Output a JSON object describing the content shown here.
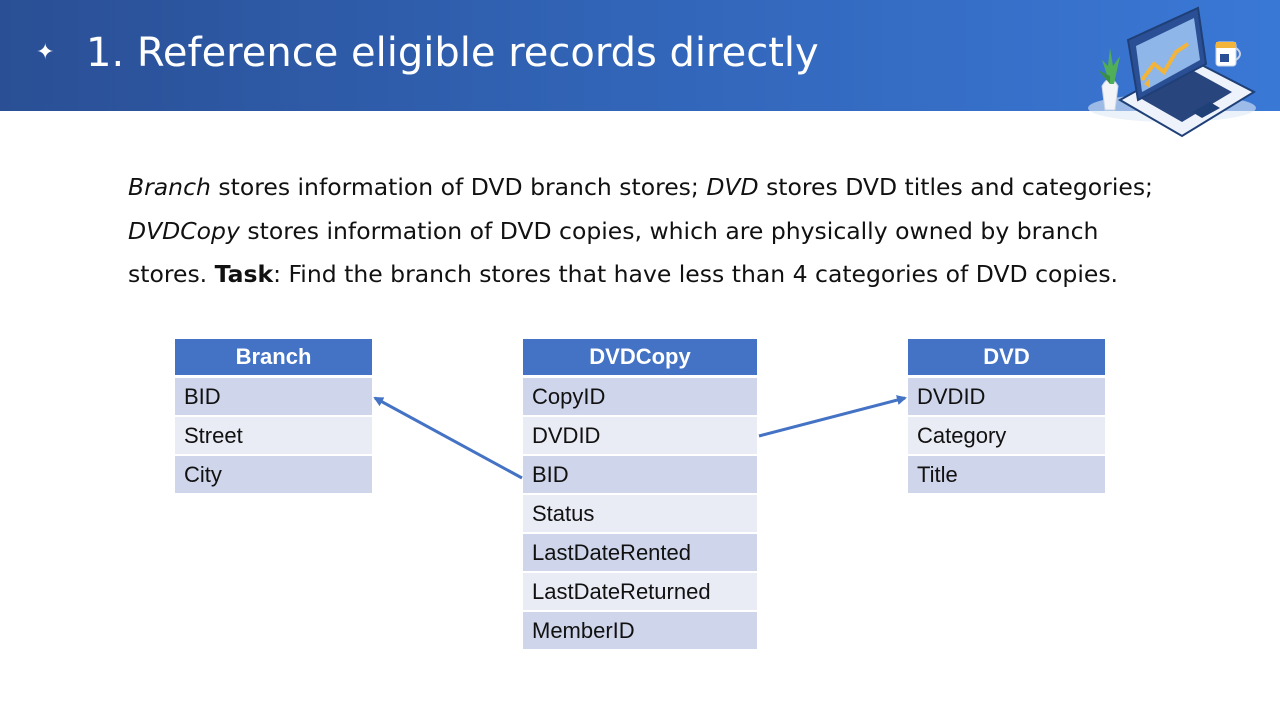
{
  "header": {
    "bullet": "✦",
    "title": "1. Reference eligible records directly"
  },
  "paragraph": {
    "line1": {
      "branch": "Branch",
      "text1": " stores information of DVD branch stores; ",
      "dvd": "DVD",
      "text2": " stores DVD titles and categories;"
    },
    "line2": {
      "dvdcopy": "DVDCopy",
      "text": " stores information of DVD copies, which are physically owned by branch"
    },
    "line3": {
      "text1": "stores. ",
      "task": "Task",
      "text2": ": Find the branch stores that have less than 4 categories of DVD copies."
    }
  },
  "tables": {
    "branch": {
      "name": "Branch",
      "fields": [
        "BID",
        "Street",
        "City"
      ]
    },
    "dvdcopy": {
      "name": "DVDCopy",
      "fields": [
        "CopyID",
        "DVDID",
        "BID",
        "Status",
        "LastDateRented",
        "LastDateReturned",
        "MemberID"
      ]
    },
    "dvd": {
      "name": "DVD",
      "fields": [
        "DVDID",
        "Category",
        "Title"
      ]
    }
  },
  "relations": [
    {
      "from": "DVDCopy.BID",
      "to": "Branch.BID"
    },
    {
      "from": "DVDCopy.DVDID",
      "to": "DVD.DVDID"
    }
  ],
  "colors": {
    "header_bg": "#3163b5",
    "table_header": "#4472c4",
    "row_odd": "#cfd5ea",
    "row_even": "#e9ebf5",
    "arrow": "#4472c4"
  }
}
